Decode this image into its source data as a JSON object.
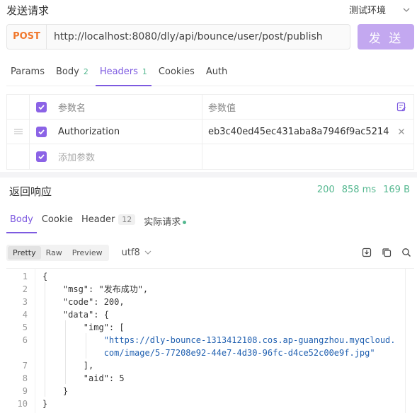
{
  "page": {
    "title": "发送请求",
    "environment": "测试环境"
  },
  "request": {
    "method": "POST",
    "url": "http://localhost:8080/dly/api/bounce/user/post/publish",
    "send_label": "发 送"
  },
  "request_tabs": [
    {
      "label": "Params",
      "count": ""
    },
    {
      "label": "Body",
      "count": "2"
    },
    {
      "label": "Headers",
      "count": "1"
    },
    {
      "label": "Cookies",
      "count": ""
    },
    {
      "label": "Auth",
      "count": ""
    }
  ],
  "headers_table": {
    "col_name": "参数名",
    "col_value": "参数值",
    "rows": [
      {
        "name": "Authorization",
        "value": "eb3c40ed45ec431aba8a7946f9ac5214"
      }
    ],
    "add_placeholder": "添加参数"
  },
  "response": {
    "title": "返回响应",
    "status": "200",
    "time": "858 ms",
    "size": "169 B",
    "tabs": [
      {
        "label": "Body",
        "count": ""
      },
      {
        "label": "Cookie",
        "count": ""
      },
      {
        "label": "Header",
        "count": "12"
      },
      {
        "label": "实际请求",
        "count": ""
      }
    ],
    "view_modes": [
      "Pretty",
      "Raw",
      "Preview"
    ],
    "encoding": "utf8",
    "code_lines": [
      {
        "num": "1",
        "text": "{"
      },
      {
        "num": "2",
        "text": "    \"msg\": \"发布成功\","
      },
      {
        "num": "3",
        "text": "    \"code\": 200,"
      },
      {
        "num": "4",
        "text": "    \"data\": {"
      },
      {
        "num": "5",
        "text": "        \"img\": ["
      },
      {
        "num": "6",
        "text": "            \"https://dly-bounce-1313412108.cos.ap-guangzhou.myqcloud."
      },
      {
        "num": "",
        "text": "            com/image/5-77208e92-44e7-4d30-96fc-d4ce52c00e9f.jpg\""
      },
      {
        "num": "7",
        "text": "        ],"
      },
      {
        "num": "8",
        "text": "        \"aid\": 5"
      },
      {
        "num": "9",
        "text": "    }"
      },
      {
        "num": "10",
        "text": "}"
      }
    ]
  },
  "colors": {
    "accent": "#7d5ae0",
    "send_button": "#c3a8f0",
    "method": "#f0782d",
    "success": "#55b890"
  },
  "icons": [
    "chevron-down-icon",
    "drag-handle-icon",
    "check-icon",
    "bulk-edit-icon",
    "delete-icon",
    "download-icon",
    "copy-icon",
    "search-icon"
  ]
}
